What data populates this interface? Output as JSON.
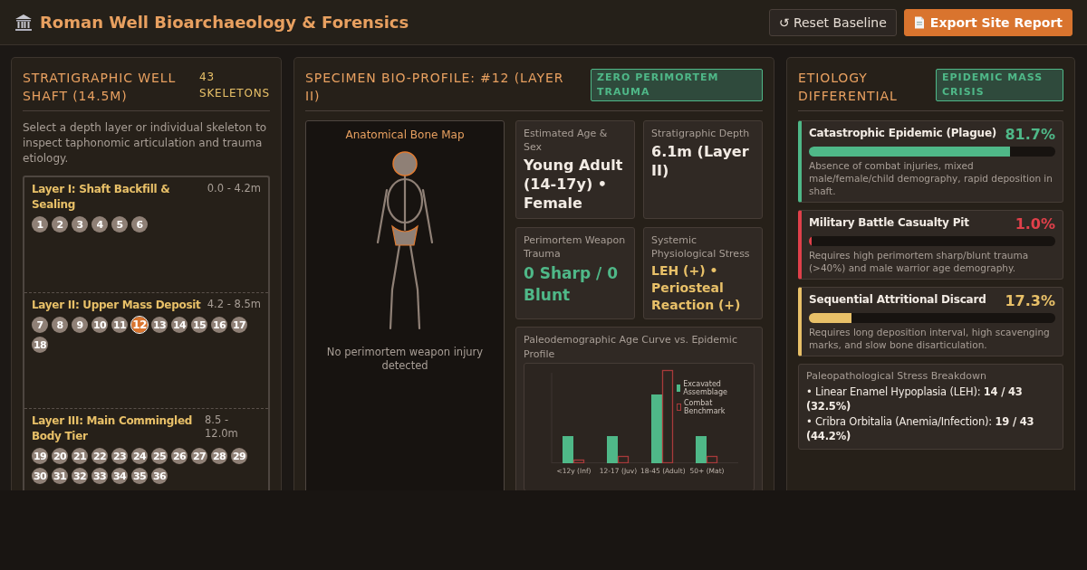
{
  "header": {
    "title": "Roman Well Bioarchaeology & Forensics",
    "buttons": [
      {
        "label": "↺ Reset Baseline",
        "kind": "secondary"
      },
      {
        "label": "Export Site Report",
        "kind": "primary"
      }
    ]
  },
  "well_panel": {
    "title": "STRATIGRAPHIC WELL SHAFT (14.5M)",
    "count": "43 SKELETONS",
    "hint": "Select a depth layer or individual skeleton to inspect taphonomic articulation and trauma etiology.",
    "layers": [
      {
        "name": "Layer I: Shaft Backfill & Sealing",
        "range": "0.0 - 4.2m",
        "skeletons": [
          {
            "label": "1",
            "selected": false
          },
          {
            "label": "2",
            "selected": false
          },
          {
            "label": "3",
            "selected": false
          },
          {
            "label": "4",
            "selected": false
          },
          {
            "label": "5",
            "selected": false
          },
          {
            "label": "6",
            "selected": false
          }
        ]
      },
      {
        "name": "Layer II: Upper Mass Deposit",
        "range": "4.2 - 8.5m",
        "skeletons": [
          {
            "label": "7",
            "selected": false
          },
          {
            "label": "8",
            "selected": false
          },
          {
            "label": "9",
            "selected": false
          },
          {
            "label": "10",
            "selected": false
          },
          {
            "label": "11",
            "selected": false
          },
          {
            "label": "12",
            "selected": true
          },
          {
            "label": "13",
            "selected": false
          },
          {
            "label": "14",
            "selected": false
          },
          {
            "label": "15",
            "selected": false
          },
          {
            "label": "16",
            "selected": false
          },
          {
            "label": "17",
            "selected": false
          },
          {
            "label": "18",
            "selected": false
          }
        ]
      },
      {
        "name": "Layer III: Main Commingled Body Tier",
        "range": "8.5 - 12.0m",
        "skeletons": [
          {
            "label": "19",
            "selected": false
          },
          {
            "label": "20",
            "selected": false
          },
          {
            "label": "21",
            "selected": false
          },
          {
            "label": "22",
            "selected": false
          },
          {
            "label": "23",
            "selected": false
          },
          {
            "label": "24",
            "selected": false
          },
          {
            "label": "25",
            "selected": false
          },
          {
            "label": "26",
            "selected": false
          },
          {
            "label": "27",
            "selected": false
          },
          {
            "label": "28",
            "selected": false
          },
          {
            "label": "29",
            "selected": false
          },
          {
            "label": "30",
            "selected": false
          },
          {
            "label": "31",
            "selected": false
          },
          {
            "label": "32",
            "selected": false
          },
          {
            "label": "33",
            "selected": false
          },
          {
            "label": "34",
            "selected": false
          },
          {
            "label": "35",
            "selected": false
          },
          {
            "label": "36",
            "selected": false
          }
        ]
      }
    ]
  },
  "specimen_panel": {
    "title": "SPECIMEN BIO-PROFILE: #12 (LAYER II)",
    "badge": "ZERO PERIMORTEM TRAUMA",
    "bone_map": {
      "title": "Anatomical Bone Map",
      "note": "No perimortem weapon injury detected"
    },
    "stats": [
      {
        "label": "Estimated Age & Sex",
        "value": "Young Adult (14-17y) • Female",
        "kind": "plain"
      },
      {
        "label": "Stratigraphic Depth",
        "value": "6.1m (Layer II)",
        "kind": "plain"
      },
      {
        "label": "Perimortem Weapon Trauma",
        "value": "0 Sharp / 0 Blunt",
        "kind": "good"
      },
      {
        "label": "Systemic Physiological Stress",
        "value": "LEH (+) • Periosteal Reaction (+)",
        "kind": "warn"
      }
    ],
    "chart": {
      "title": "Paleodemographic Age Curve vs. Epidemic Profile",
      "legend": [
        {
          "label": "Excavated Assemblage",
          "kind": "filled"
        },
        {
          "label": "Combat Benchmark",
          "kind": "outline"
        }
      ],
      "categories": [
        "<12y (Inf)",
        "12-17 (Juv)",
        "18-45 (Adult)",
        "50+ (Mat)"
      ]
    }
  },
  "etiology_panel": {
    "title": "ETIOLOGY DIFFERENTIAL",
    "badge": "EPIDEMIC MASS CRISIS",
    "hypotheses": [
      {
        "name": "Catastrophic Epidemic (Plague)",
        "percent": "81.7%",
        "level": 0.817,
        "color": "#4fb888",
        "description": "Absence of combat injuries, mixed male/female/child demography, rapid deposition in shaft."
      },
      {
        "name": "Military Battle Casualty Pit",
        "percent": "1.0%",
        "level": 0.01,
        "color": "#e0404a",
        "description": "Requires high perimortem sharp/blunt trauma (>40%) and male warrior age demography."
      },
      {
        "name": "Sequential Attritional Discard",
        "percent": "17.3%",
        "level": 0.173,
        "color": "#e8c068",
        "description": "Requires long deposition interval, high scavenging marks, and slow bone disarticulation."
      }
    ],
    "breakdown": {
      "title": "Paleopathological Stress Breakdown",
      "items": [
        "• Linear Enamel Hypoplasia (LEH): **14 / 43 (32.5%)**",
        "• Cribra Orbitalia (Anemia/Infection): **19 / 43 (44.2%)**"
      ]
    }
  }
}
